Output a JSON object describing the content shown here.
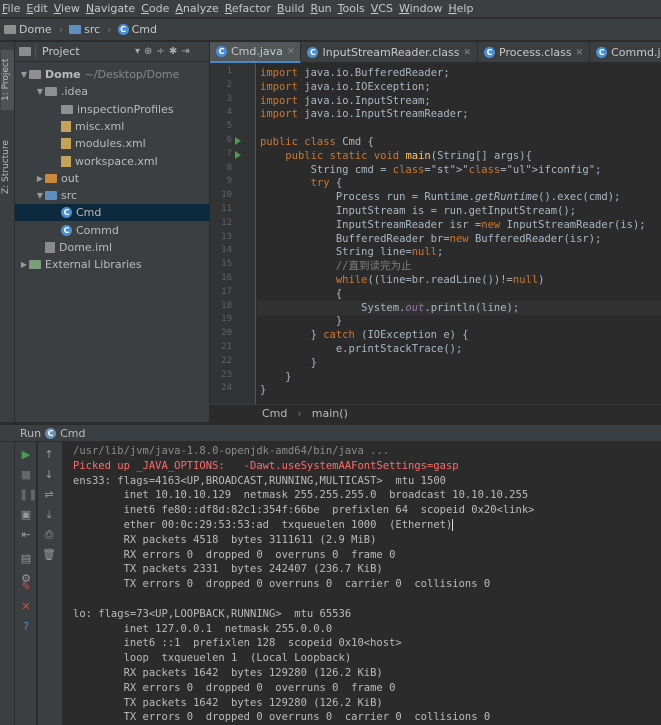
{
  "menu": [
    "File",
    "Edit",
    "View",
    "Navigate",
    "Code",
    "Analyze",
    "Refactor",
    "Build",
    "Run",
    "Tools",
    "VCS",
    "Window",
    "Help"
  ],
  "breadcrumb": [
    "Dome",
    "src",
    "Cmd"
  ],
  "leftstrip": {
    "project_tab": "1: Project",
    "structure_tab": "Z: Structure"
  },
  "project_panel": {
    "selector": "Project",
    "tree": [
      {
        "label": "Dome",
        "suffix": "~/Desktop/Dome",
        "icon": "folder-icon",
        "depth": 0,
        "arrow": "▼"
      },
      {
        "label": ".idea",
        "depth": 1,
        "icon": "folder-icon",
        "arrow": "▼"
      },
      {
        "label": "inspectionProfiles",
        "depth": 2,
        "icon": "folder-icon",
        "arrow": ""
      },
      {
        "label": "misc.xml",
        "depth": 2,
        "icon": "xml-file-icon",
        "arrow": ""
      },
      {
        "label": "modules.xml",
        "depth": 2,
        "icon": "xml-file-icon",
        "arrow": ""
      },
      {
        "label": "workspace.xml",
        "depth": 2,
        "icon": "xml-file-icon",
        "arrow": ""
      },
      {
        "label": "out",
        "depth": 1,
        "icon": "folder-icon",
        "arrow": "▶"
      },
      {
        "label": "src",
        "depth": 1,
        "icon": "source-folder-icon",
        "arrow": "▼"
      },
      {
        "label": "Cmd",
        "depth": 2,
        "icon": "class-icon",
        "arrow": "",
        "selected": true
      },
      {
        "label": "Commd",
        "depth": 2,
        "icon": "class-icon",
        "arrow": ""
      },
      {
        "label": "Dome.iml",
        "depth": 1,
        "icon": "iml-file-icon",
        "arrow": ""
      },
      {
        "label": "External Libraries",
        "depth": 0,
        "icon": "library-icon",
        "arrow": "▶"
      }
    ]
  },
  "editor": {
    "tabs": [
      {
        "label": "Cmd.java",
        "active": true
      },
      {
        "label": "InputStreamReader.class",
        "active": false
      },
      {
        "label": "Process.class",
        "active": false
      },
      {
        "label": "Commd.java",
        "active": false
      }
    ],
    "line_numbers": [
      "1",
      "2",
      "3",
      "4",
      "5",
      "6",
      "7",
      "8",
      "9",
      "10",
      "11",
      "12",
      "13",
      "14",
      "15",
      "16",
      "17",
      "18",
      "19",
      "20",
      "21",
      "22",
      "23",
      "24"
    ],
    "lines": [
      "import java.io.BufferedReader;",
      "import java.io.IOException;",
      "import java.io.InputStream;",
      "import java.io.InputStreamReader;",
      "",
      "public class Cmd {",
      "    public static void main(String[] args){",
      "        String cmd = \"ifconfig\";",
      "        try {",
      "            Process run = Runtime.getRuntime().exec(cmd);",
      "            InputStream is = run.getInputStream();",
      "            InputStreamReader isr =new InputStreamReader(is);",
      "            BufferedReader br=new BufferedReader(isr);",
      "            String line=null;",
      "            //直到读完为止",
      "            while((line=br.readLine())!=null)",
      "            {",
      "                System.out.println(line);",
      "            }",
      "        } catch (IOException e) {",
      "            e.printStackTrace();",
      "        }",
      "    }",
      "}"
    ],
    "status": {
      "class": "Cmd",
      "method": "main()"
    }
  },
  "run": {
    "header_label": "Run",
    "config_name": "Cmd",
    "console": [
      "/usr/lib/jvm/java-1.8.0-openjdk-amd64/bin/java ...",
      "Picked up _JAVA_OPTIONS:   -Dawt.useSystemAAFontSettings=gasp",
      "ens33: flags=4163<UP,BROADCAST,RUNNING,MULTICAST>  mtu 1500",
      "        inet 10.10.10.129  netmask 255.255.255.0  broadcast 10.10.10.255",
      "        inet6 fe80::df8d:82c1:354f:66be  prefixlen 64  scopeid 0x20<link>",
      "        ether 00:0c:29:53:53:ad  txqueuelen 1000  (Ethernet)",
      "        RX packets 4518  bytes 3111611 (2.9 MiB)",
      "        RX errors 0  dropped 0  overruns 0  frame 0",
      "        TX packets 2331  bytes 242407 (236.7 KiB)",
      "        TX errors 0  dropped 0 overruns 0  carrier 0  collisions 0",
      "",
      "lo: flags=73<UP,LOOPBACK,RUNNING>  mtu 65536",
      "        inet 127.0.0.1  netmask 255.0.0.0",
      "        inet6 ::1  prefixlen 128  scopeid 0x10<host>",
      "        loop  txqueuelen 1  (Local Loopback)",
      "        RX packets 1642  bytes 129280 (126.2 KiB)",
      "        RX errors 0  dropped 0  overruns 0  frame 0",
      "        TX packets 1642  bytes 129280 (126.2 KiB)",
      "        TX errors 0  dropped 0 overruns 0  carrier 0  collisions 0"
    ]
  },
  "colors": {
    "background": "#2b2b2b",
    "panel": "#3c3f41",
    "keyword": "#cc7832",
    "string": "#6a8759",
    "error": "#ff6b68",
    "selection": "#0d293e"
  }
}
